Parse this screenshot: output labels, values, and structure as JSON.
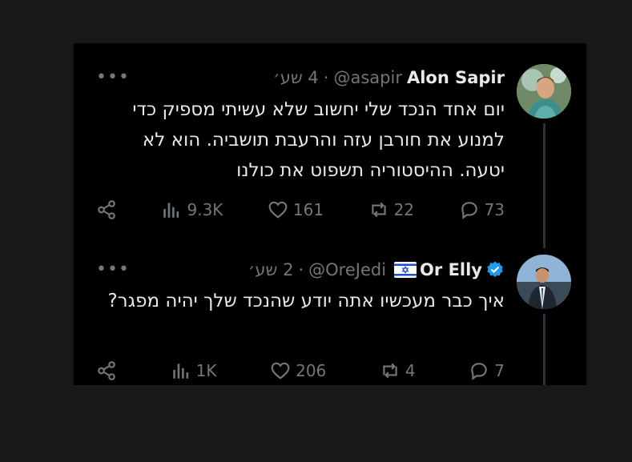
{
  "tweets": [
    {
      "name": "Alon Sapir",
      "handle": "@asapir",
      "separator": "·",
      "time": "4 שע׳",
      "text": "יום אחד הנכד שלי יחשוב שלא עשיתי מספיק כדי למנוע את חורבן עזה והרעבת תושביה. הוא לא יטעה. ההיסטוריה תשפוט את כולנו",
      "stats": {
        "replies": "73",
        "retweets": "22",
        "likes": "161",
        "views": "9.3K"
      },
      "verified": false,
      "flag": false
    },
    {
      "name": "Or Elly",
      "handle": "@OreJedi",
      "separator": "·",
      "time": "2 שע׳",
      "text": "איך כבר מעכשיו אתה יודע שהנכד שלך יהיה מפגר?",
      "stats": {
        "replies": "7",
        "retweets": "4",
        "likes": "206",
        "views": "1K"
      },
      "verified": true,
      "flag": true
    }
  ],
  "more_label": "•••",
  "colors": {
    "text": "#e7e9ea",
    "muted": "#71767b",
    "verified": "#1d9bf0",
    "background": "#000000"
  }
}
